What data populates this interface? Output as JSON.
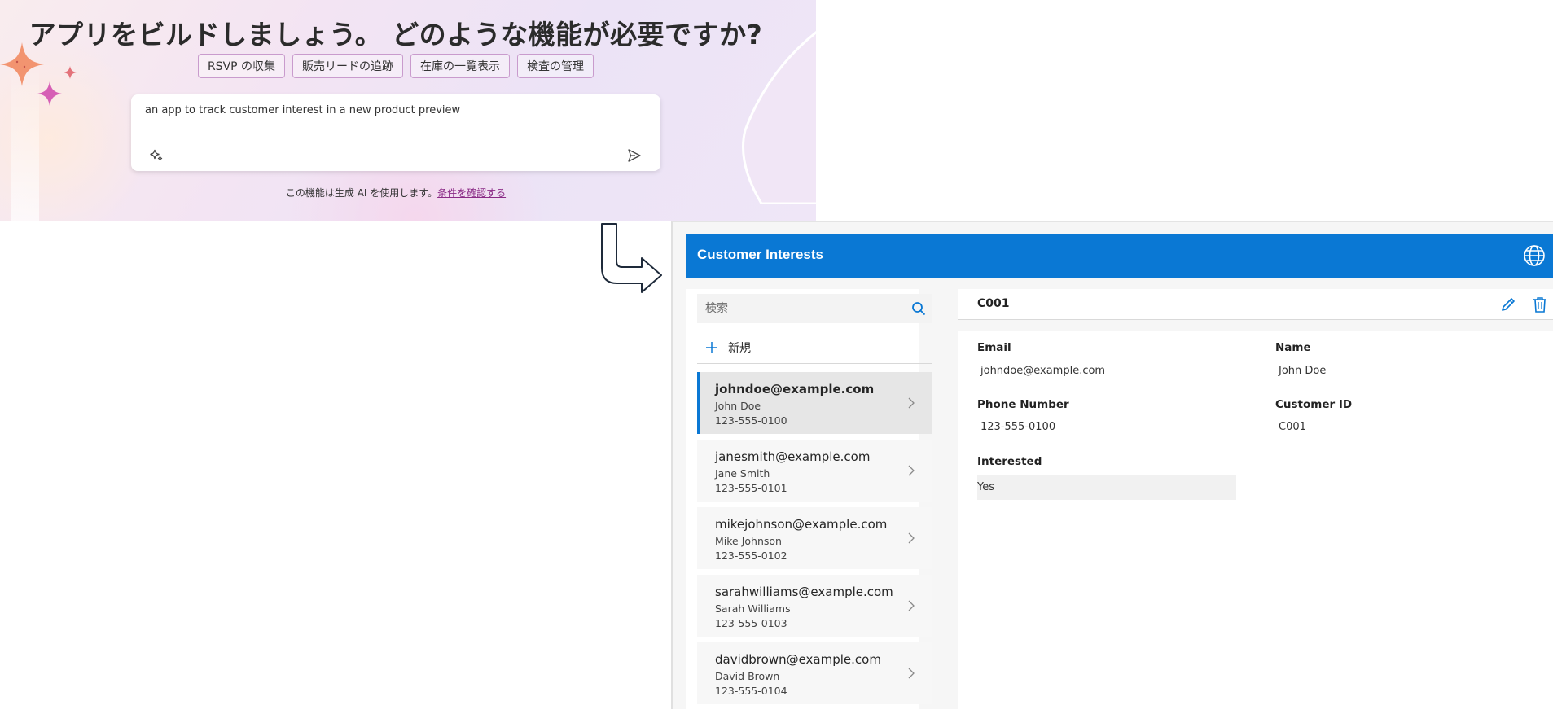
{
  "banner": {
    "title": "アプリをビルドしましょう。 どのような機能が必要ですか?",
    "chips": [
      "RSVP の収集",
      "販売リードの追跡",
      "在庫の一覧表示",
      "検査の管理"
    ],
    "prompt_text": "an app to track customer interest in a new product preview",
    "disclaimer_text": "この機能は生成 AI を使用します。",
    "disclaimer_link": "条件を確認する"
  },
  "app": {
    "title": "Customer Interests",
    "search_placeholder": "検索",
    "new_label": "新規",
    "records": [
      {
        "email": "johndoe@example.com",
        "name": "John Doe",
        "phone": "123-555-0100"
      },
      {
        "email": "janesmith@example.com",
        "name": "Jane Smith",
        "phone": "123-555-0101"
      },
      {
        "email": "mikejohnson@example.com",
        "name": "Mike Johnson",
        "phone": "123-555-0102"
      },
      {
        "email": "sarahwilliams@example.com",
        "name": "Sarah Williams",
        "phone": "123-555-0103"
      },
      {
        "email": "davidbrown@example.com",
        "name": "David Brown",
        "phone": "123-555-0104"
      }
    ],
    "detail": {
      "id": "C001",
      "email_label": "Email",
      "email_value": "johndoe@example.com",
      "name_label": "Name",
      "name_value": "John Doe",
      "phone_label": "Phone Number",
      "phone_value": "123-555-0100",
      "customer_id_label": "Customer ID",
      "customer_id_value": "C001",
      "interested_label": "Interested",
      "interested_value": "Yes"
    }
  },
  "colors": {
    "accent": "#0a78d4",
    "chip_border": "#c99bcd",
    "link": "#8a2a86"
  },
  "icons": [
    "sparkle-icon",
    "send-icon",
    "globe-icon",
    "search-icon",
    "plus-icon",
    "chevron-right-icon",
    "edit-icon",
    "delete-icon",
    "flow-arrow-icon"
  ]
}
